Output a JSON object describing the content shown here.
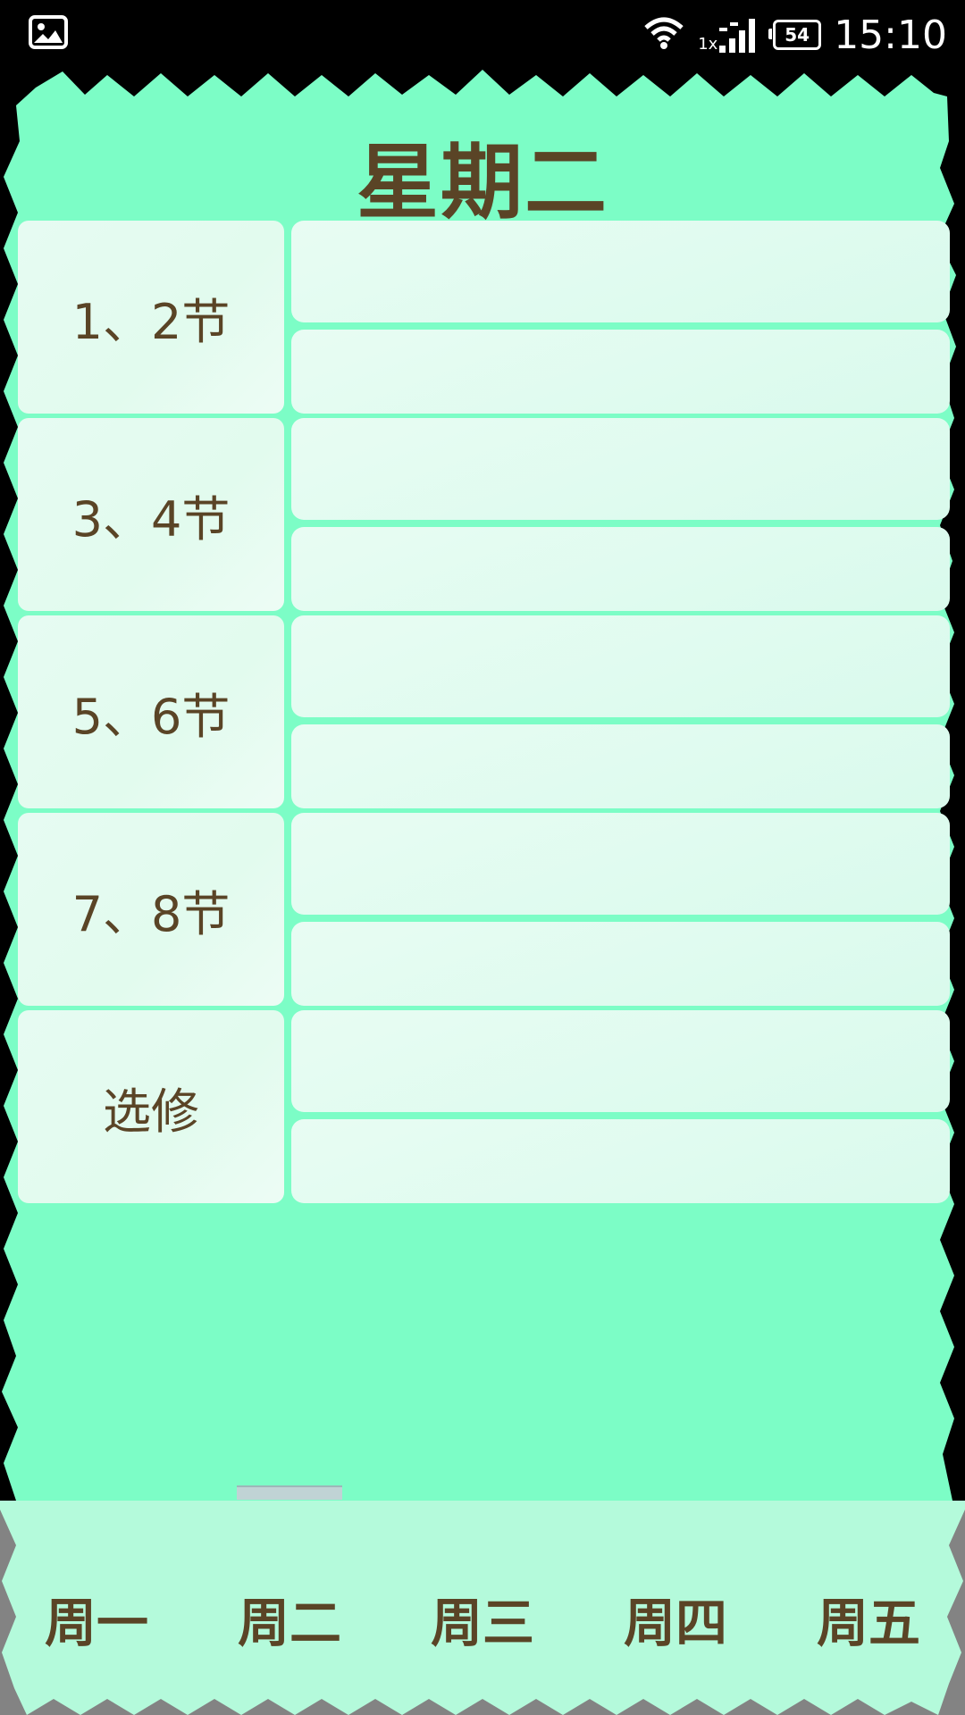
{
  "status_bar": {
    "time": "15:10",
    "battery": "54",
    "network_label": "1x",
    "left_icon": "image-icon",
    "wifi_icon": "wifi-icon",
    "signal_icon": "signal-icon"
  },
  "page": {
    "title": "星期二"
  },
  "schedule": {
    "rows": [
      {
        "label": "1、2节"
      },
      {
        "label": "3、4节"
      },
      {
        "label": "5、6节"
      },
      {
        "label": "7、8节"
      },
      {
        "label": "选修"
      }
    ]
  },
  "tabs": [
    {
      "label": "周一"
    },
    {
      "label": "周二"
    },
    {
      "label": "周三"
    },
    {
      "label": "周四"
    },
    {
      "label": "周五"
    }
  ],
  "selected_tab": "周二",
  "colors": {
    "accent_green": "#7cfdc6",
    "text_brown": "#5a4426",
    "cell_bg": "#e2fbee",
    "tabbar_light": "#b4fadb"
  }
}
